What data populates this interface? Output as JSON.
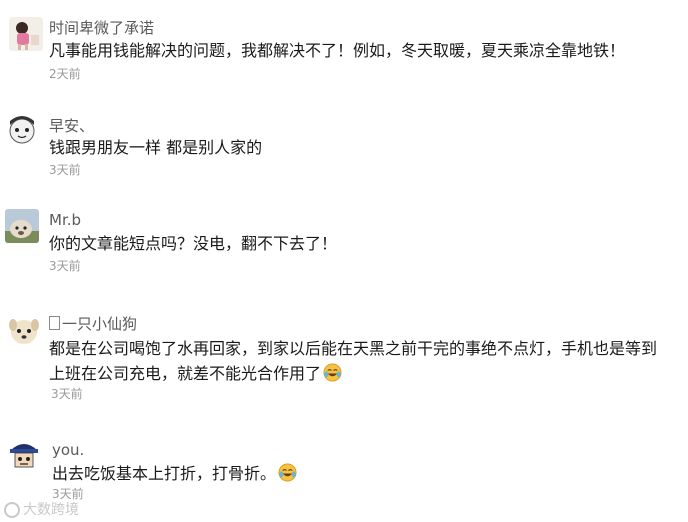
{
  "comments": [
    {
      "name": "时间卑微了承诺",
      "lines": [
        "凡事能用钱能解决的问题，我都解决不了！例如，冬天取暖，夏天乘凉全靠地铁！"
      ],
      "time": "2天前",
      "avatar": "avatar-girl"
    },
    {
      "name": "早安、",
      "lines": [
        "钱跟男朋友一样  都是别人家的"
      ],
      "time": "3天前",
      "avatar": "avatar-cartoon-face"
    },
    {
      "name": "Mr.b",
      "lines": [
        "你的文章能短点吗？没电，翻不下去了！"
      ],
      "time": "3天前",
      "avatar": "avatar-alpaca"
    },
    {
      "name": "一只小仙狗",
      "lines": [
        "都是在公司喝饱了水再回家，到家以后能在天黑之前干完的事绝不点灯，手机也是等到",
        "上班在公司充电，就差不能光合作用了"
      ],
      "time": "3天前",
      "avatar": "avatar-dog"
    },
    {
      "name": "you.",
      "lines": [
        "出去吃饭基本上打折，打骨折。"
      ],
      "time": "3天前",
      "avatar": "avatar-cartoon-hat"
    }
  ],
  "watermark": "大数跨境",
  "colors": {
    "name": "#5a5a5a",
    "text": "#1a1a1a",
    "time": "#9a9a9a",
    "emoji": "#f5c242"
  },
  "icons": {
    "emoji": "laughing-tears-emoji-icon",
    "watermark": "watermark-logo-icon"
  }
}
